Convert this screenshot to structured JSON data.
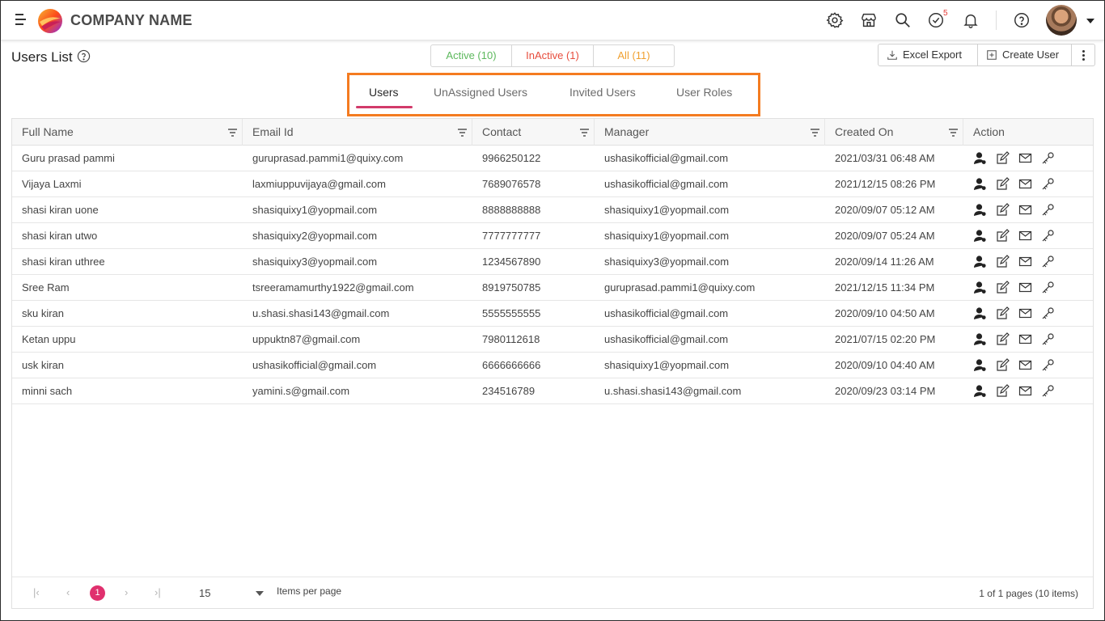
{
  "header": {
    "company_name": "COMPANY NAME",
    "notification_count": "5"
  },
  "page": {
    "title": "Users List"
  },
  "status_filters": {
    "active": "Active (10)",
    "inactive": "InActive (1)",
    "all": "All (11)"
  },
  "toolbar": {
    "excel_export": "Excel Export",
    "create_user": "Create User"
  },
  "tabs": [
    {
      "label": "Users"
    },
    {
      "label": "UnAssigned Users"
    },
    {
      "label": "Invited Users"
    },
    {
      "label": "User Roles"
    }
  ],
  "columns": [
    "Full Name",
    "Email Id",
    "Contact",
    "Manager",
    "Created On",
    "Action"
  ],
  "rows": [
    {
      "name": "Guru prasad pammi",
      "email": "guruprasad.pammi1@quixy.com",
      "contact": "9966250122",
      "manager": "ushasikofficial@gmail.com",
      "created": "2021/03/31 06:48 AM"
    },
    {
      "name": "Vijaya Laxmi",
      "email": "laxmiuppuvijaya@gmail.com",
      "contact": "7689076578",
      "manager": "ushasikofficial@gmail.com",
      "created": "2021/12/15 08:26 PM"
    },
    {
      "name": "shasi kiran uone",
      "email": "shasiquixy1@yopmail.com",
      "contact": "8888888888",
      "manager": "shasiquixy1@yopmail.com",
      "created": "2020/09/07 05:12 AM"
    },
    {
      "name": "shasi kiran utwo",
      "email": "shasiquixy2@yopmail.com",
      "contact": "7777777777",
      "manager": "shasiquixy1@yopmail.com",
      "created": "2020/09/07 05:24 AM"
    },
    {
      "name": "shasi kiran uthree",
      "email": "shasiquixy3@yopmail.com",
      "contact": "1234567890",
      "manager": "shasiquixy3@yopmail.com",
      "created": "2020/09/14 11:26 AM"
    },
    {
      "name": "Sree Ram",
      "email": "tsreeramamurthy1922@gmail.com",
      "contact": "8919750785",
      "manager": "guruprasad.pammi1@quixy.com",
      "created": "2021/12/15 11:34 PM"
    },
    {
      "name": "sku kiran",
      "email": "u.shasi.shasi143@gmail.com",
      "contact": "5555555555",
      "manager": "ushasikofficial@gmail.com",
      "created": "2020/09/10 04:50 AM"
    },
    {
      "name": "Ketan uppu",
      "email": "uppuktn87@gmail.com",
      "contact": "7980112618",
      "manager": "ushasikofficial@gmail.com",
      "created": "2021/07/15 02:20 PM"
    },
    {
      "name": "usk kiran",
      "email": "ushasikofficial@gmail.com",
      "contact": "6666666666",
      "manager": "shasiquixy1@yopmail.com",
      "created": "2020/09/10 04:40 AM"
    },
    {
      "name": "minni sach",
      "email": "yamini.s@gmail.com",
      "contact": "234516789",
      "manager": "u.shasi.shasi143@gmail.com",
      "created": "2020/09/23 03:14 PM"
    }
  ],
  "pager": {
    "current_page": "1",
    "page_size": "15",
    "items_per_page_label": "Items per page",
    "info": "1 of 1 pages (10 items)"
  },
  "colors": {
    "active": "#5cb85c",
    "inactive": "#e74c3c",
    "all": "#f0a030",
    "tab_highlight": "#f47b20",
    "tab_underline": "#d23a6a",
    "page_badge": "#e0306e"
  }
}
